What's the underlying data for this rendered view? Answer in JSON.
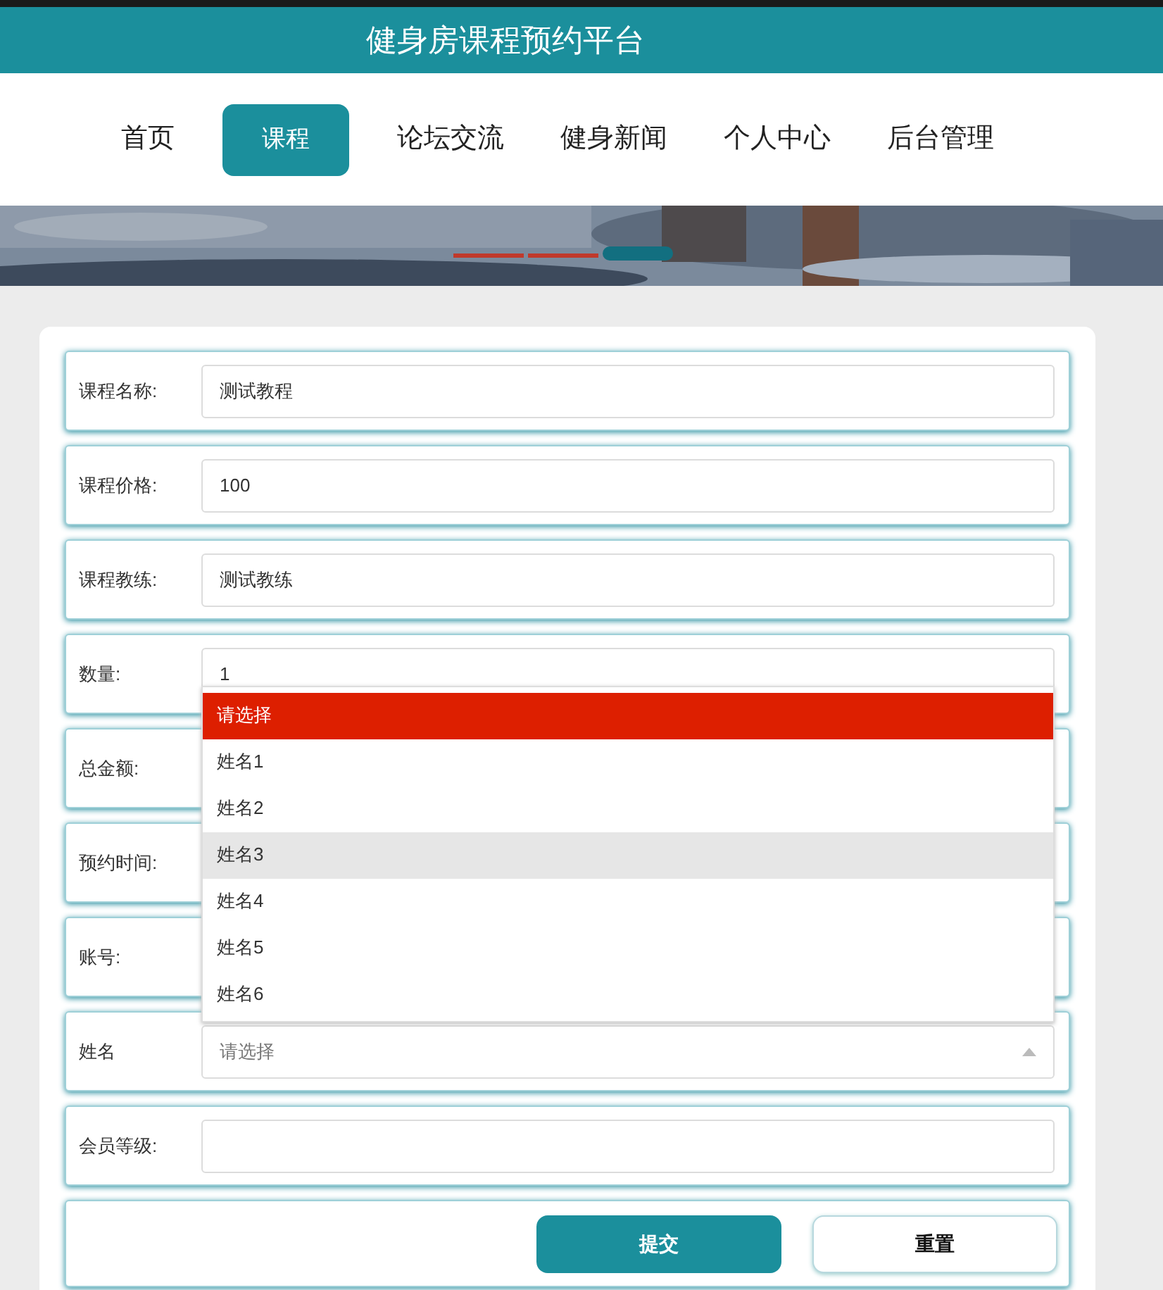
{
  "header": {
    "title": "健身房课程预约平台"
  },
  "nav": [
    {
      "label": "首页",
      "selected": false
    },
    {
      "label": "课程",
      "selected": true
    },
    {
      "label": "论坛交流",
      "selected": false
    },
    {
      "label": "健身新闻",
      "selected": false
    },
    {
      "label": "个人中心",
      "selected": false
    },
    {
      "label": "后台管理",
      "selected": false
    }
  ],
  "banner": {
    "kind": "picture",
    "indicators": [
      {
        "selected": false
      },
      {
        "selected": false
      },
      {
        "selected": true
      }
    ]
  },
  "form": {
    "fields": [
      {
        "kind": "text",
        "label": "课程名称:",
        "value": "测试教程"
      },
      {
        "kind": "text",
        "label": "课程价格:",
        "value": "100"
      },
      {
        "kind": "text",
        "label": "课程教练:",
        "value": "测试教练"
      },
      {
        "kind": "text",
        "label": "数量:",
        "value": "1"
      },
      {
        "kind": "covered",
        "label": "总金额:"
      },
      {
        "kind": "covered",
        "label": "预约时间:"
      },
      {
        "kind": "covered",
        "label": "账号:"
      },
      {
        "kind": "select",
        "label": "姓名",
        "placeholder": "请选择",
        "expanded": true,
        "options": [
          {
            "label": "请选择",
            "selected": true,
            "hovered": false
          },
          {
            "label": "姓名1",
            "selected": false,
            "hovered": false
          },
          {
            "label": "姓名2",
            "selected": false,
            "hovered": false
          },
          {
            "label": "姓名3",
            "selected": false,
            "hovered": true
          },
          {
            "label": "姓名4",
            "selected": false,
            "hovered": false
          },
          {
            "label": "姓名5",
            "selected": false,
            "hovered": false
          },
          {
            "label": "姓名6",
            "selected": false,
            "hovered": false
          }
        ]
      },
      {
        "kind": "text",
        "label": "会员等级:"
      }
    ],
    "buttons": [
      {
        "label": "提交",
        "kind": "primary"
      },
      {
        "label": "重置",
        "kind": "secondary"
      }
    ]
  }
}
